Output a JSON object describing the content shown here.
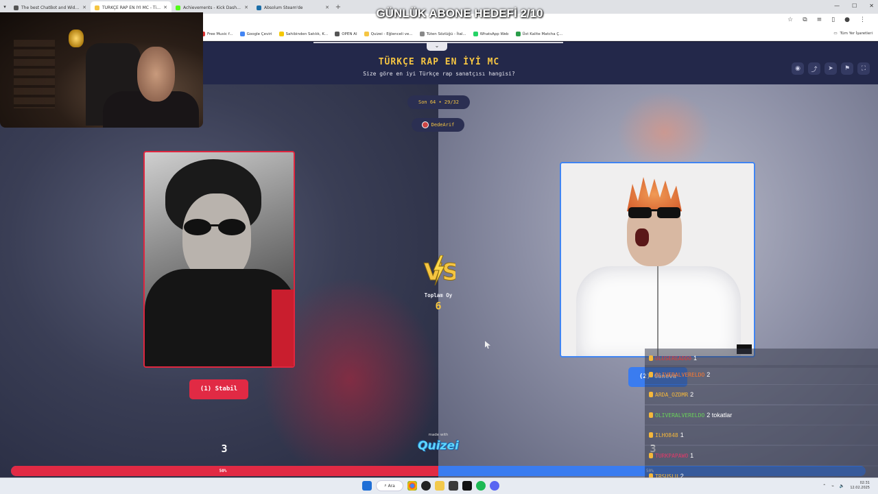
{
  "browser": {
    "tabs": [
      {
        "label": "The best ChatBot and Widgets",
        "active": false,
        "icon": "bot-icon"
      },
      {
        "label": "TÜRKÇE RAP EN İYİ MC - Tier l",
        "active": true,
        "icon": "quizei-icon"
      },
      {
        "label": "Achievements - Kick Dashboard",
        "active": false,
        "icon": "kick-icon"
      },
      {
        "label": "Absolum Steam'de",
        "active": false,
        "icon": "steam-icon"
      }
    ],
    "new_tab": "+",
    "bookmarks": [
      {
        "label": "Free Music f..."
      },
      {
        "label": "Google Çeviri"
      },
      {
        "label": "Sahibinden Satılık, K..."
      },
      {
        "label": "OPEN AI"
      },
      {
        "label": "Quizei - Eğlenceli ve..."
      },
      {
        "label": "Tüten Sözlüğü - İtal..."
      },
      {
        "label": "WhatsApp Web"
      },
      {
        "label": "Üst Kalite Matcha Ç..."
      }
    ],
    "all_bookmarks": "Tüm Yer İşaretleri"
  },
  "stream_overlay": {
    "title": "GÜNLÜK ABONE HEDEFİ 2/10"
  },
  "quiz": {
    "title": "TÜRKÇE RAP EN İYİ MC",
    "subtitle": "Size göre en iyi Türkçe rap sanatçısı hangisi?",
    "round": "Son 64 • 29/32",
    "user": "DedeArif",
    "left_option": "(1) Stabil",
    "right_option": "(2) Güneva",
    "total_label": "Toplam Oy",
    "total_value": "6",
    "left_score": "3",
    "right_score": "3",
    "left_percent_label": "50%",
    "right_percent_label": "50%",
    "left_percent": 50,
    "made_with": "made with",
    "brand": "Quizei",
    "colors": {
      "left": "#e12a44",
      "right": "#3a7cf0",
      "accent": "#f5c542"
    }
  },
  "chat": [
    {
      "user": "ULUSEREADDO",
      "msg": "1",
      "color": "#e23a3a"
    },
    {
      "user": "OLIVERALVERELDO",
      "msg": "2",
      "color": "#ff7a2e"
    },
    {
      "user": "ARDA_OZDMR",
      "msg": "2",
      "color": "#f5b73a"
    },
    {
      "user": "OLIVERALVERELDO",
      "msg": "2 tokatlar",
      "color": "#6ad25a"
    },
    {
      "user": "ILHO848",
      "msg": "1",
      "color": "#f5b73a"
    },
    {
      "user": "TURKPAPAWO",
      "msg": "1",
      "color": "#e23a6a"
    },
    {
      "user": "TRSUSLU",
      "msg": "2",
      "color": "#f5b73a"
    }
  ],
  "taskbar": {
    "search": "Ara",
    "time": "02:31",
    "date": "12.02.2025"
  }
}
